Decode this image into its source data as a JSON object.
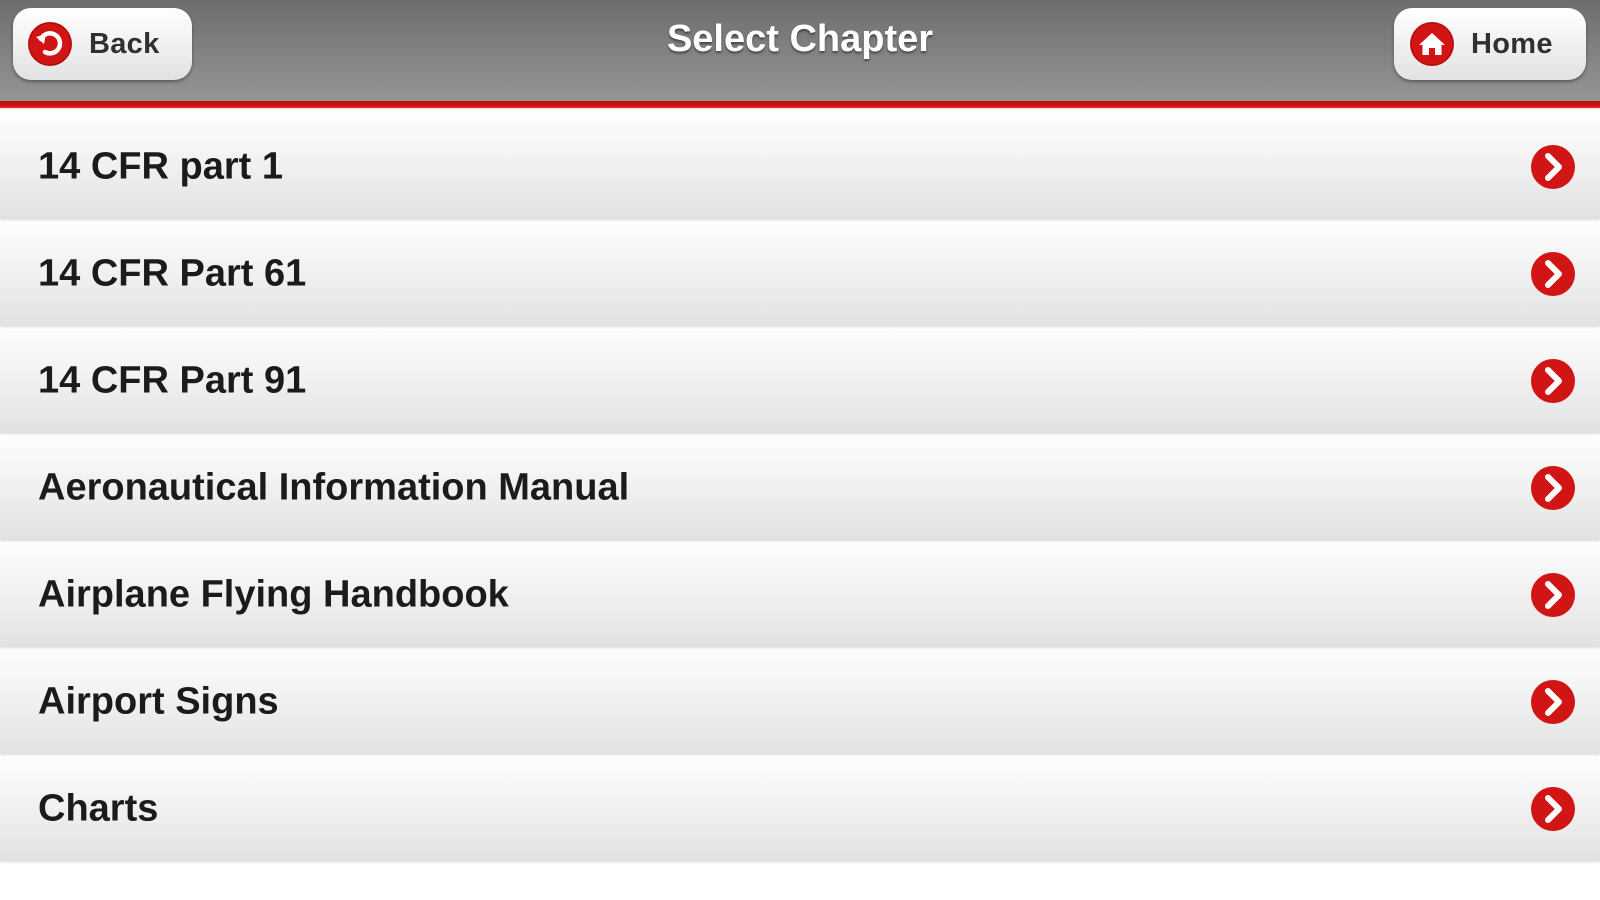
{
  "header": {
    "title": "Select Chapter",
    "back_label": "Back",
    "home_label": "Home"
  },
  "chapters": [
    {
      "label": "14 CFR part 1"
    },
    {
      "label": "14 CFR Part 61"
    },
    {
      "label": "14 CFR Part 91"
    },
    {
      "label": "Aeronautical Information Manual"
    },
    {
      "label": "Airplane Flying Handbook"
    },
    {
      "label": "Airport Signs"
    },
    {
      "label": "Charts"
    }
  ],
  "icons": {
    "back": "back-arrow-icon",
    "home": "home-icon",
    "row_arrow": "chevron-right-icon"
  },
  "colors": {
    "accent": "#d11414",
    "header_bg": "#808080"
  }
}
